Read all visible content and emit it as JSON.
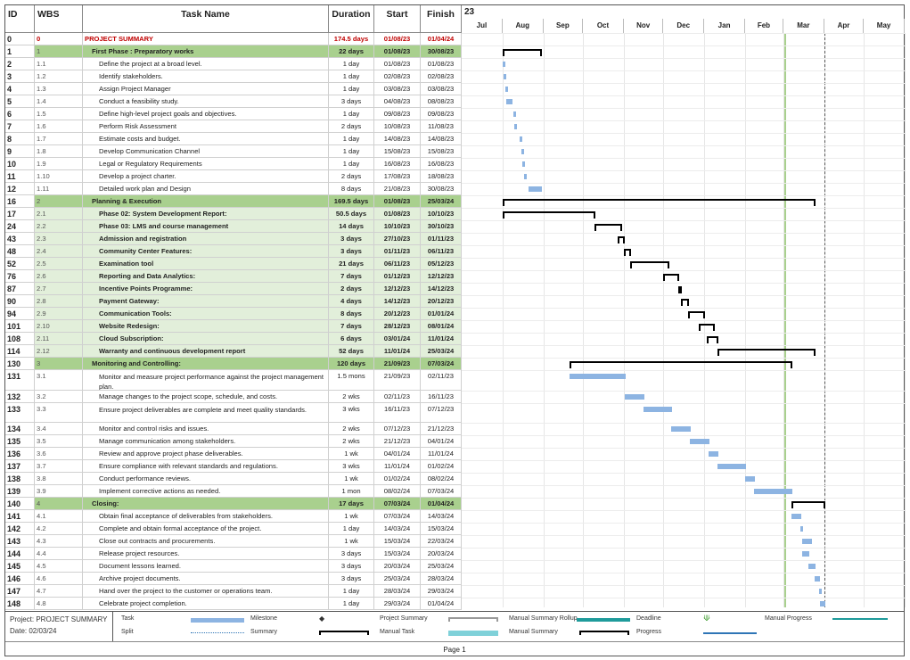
{
  "headers": {
    "id": "ID",
    "wbs": "WBS",
    "name": "Task Name",
    "duration": "Duration",
    "start": "Start",
    "finish": "Finish"
  },
  "timescale": {
    "year": "23",
    "months": [
      "Jul",
      "Aug",
      "Sep",
      "Oct",
      "Nov",
      "Dec",
      "Jan",
      "Feb",
      "Mar",
      "Apr",
      "May"
    ]
  },
  "rows": [
    {
      "id": "0",
      "wbs": "0",
      "name": "PROJECT SUMMARY",
      "dur": "174.5 days",
      "start": "01/08/23",
      "fin": "01/04/24"
    },
    {
      "id": "1",
      "wbs": "1",
      "name": "First Phase : Preparatory works",
      "dur": "22 days",
      "start": "01/08/23",
      "fin": "30/08/23"
    },
    {
      "id": "2",
      "wbs": "1.1",
      "name": "Define the project at a broad level.",
      "dur": "1 day",
      "start": "01/08/23",
      "fin": "01/08/23"
    },
    {
      "id": "3",
      "wbs": "1.2",
      "name": "Identify stakeholders.",
      "dur": "1 day",
      "start": "02/08/23",
      "fin": "02/08/23"
    },
    {
      "id": "4",
      "wbs": "1.3",
      "name": "Assign Project Manager",
      "dur": "1 day",
      "start": "03/08/23",
      "fin": "03/08/23"
    },
    {
      "id": "5",
      "wbs": "1.4",
      "name": "Conduct a feasibility study.",
      "dur": "3 days",
      "start": "04/08/23",
      "fin": "08/08/23"
    },
    {
      "id": "6",
      "wbs": "1.5",
      "name": "Define high-level project goals and objectives.",
      "dur": "1 day",
      "start": "09/08/23",
      "fin": "09/08/23"
    },
    {
      "id": "7",
      "wbs": "1.6",
      "name": "Perform Risk Assessment",
      "dur": "2 days",
      "start": "10/08/23",
      "fin": "11/08/23"
    },
    {
      "id": "8",
      "wbs": "1.7",
      "name": "Estimate costs and budget.",
      "dur": "1 day",
      "start": "14/08/23",
      "fin": "14/08/23"
    },
    {
      "id": "9",
      "wbs": "1.8",
      "name": "Develop Communication Channel",
      "dur": "1 day",
      "start": "15/08/23",
      "fin": "15/08/23"
    },
    {
      "id": "10",
      "wbs": "1.9",
      "name": "Legal or Regulatory Requirements",
      "dur": "1 day",
      "start": "16/08/23",
      "fin": "16/08/23"
    },
    {
      "id": "11",
      "wbs": "1.10",
      "name": "Develop a project charter.",
      "dur": "2 days",
      "start": "17/08/23",
      "fin": "18/08/23"
    },
    {
      "id": "12",
      "wbs": "1.11",
      "name": "Detailed work plan and Design",
      "dur": "8 days",
      "start": "21/08/23",
      "fin": "30/08/23"
    },
    {
      "id": "16",
      "wbs": "2",
      "name": "Planning & Execution",
      "dur": "169.5 days",
      "start": "01/08/23",
      "fin": "25/03/24"
    },
    {
      "id": "17",
      "wbs": "2.1",
      "name": "Phase 02: System Development Report:",
      "dur": "50.5 days",
      "start": "01/08/23",
      "fin": "10/10/23"
    },
    {
      "id": "24",
      "wbs": "2.2",
      "name": "Phase 03: LMS and course management",
      "dur": "14 days",
      "start": "10/10/23",
      "fin": "30/10/23"
    },
    {
      "id": "43",
      "wbs": "2.3",
      "name": "Admission and registration",
      "dur": "3 days",
      "start": "27/10/23",
      "fin": "01/11/23"
    },
    {
      "id": "48",
      "wbs": "2.4",
      "name": "Community Center Features:",
      "dur": "3 days",
      "start": "01/11/23",
      "fin": "06/11/23"
    },
    {
      "id": "52",
      "wbs": "2.5",
      "name": "Examination tool",
      "dur": "21 days",
      "start": "06/11/23",
      "fin": "05/12/23"
    },
    {
      "id": "76",
      "wbs": "2.6",
      "name": "Reporting and Data Analytics:",
      "dur": "7 days",
      "start": "01/12/23",
      "fin": "12/12/23"
    },
    {
      "id": "87",
      "wbs": "2.7",
      "name": "Incentive Points Programme:",
      "dur": "2 days",
      "start": "12/12/23",
      "fin": "14/12/23"
    },
    {
      "id": "90",
      "wbs": "2.8",
      "name": "Payment Gateway:",
      "dur": "4 days",
      "start": "14/12/23",
      "fin": "20/12/23"
    },
    {
      "id": "94",
      "wbs": "2.9",
      "name": "Communication Tools:",
      "dur": "8 days",
      "start": "20/12/23",
      "fin": "01/01/24"
    },
    {
      "id": "101",
      "wbs": "2.10",
      "name": "Website Redesign:",
      "dur": "7 days",
      "start": "28/12/23",
      "fin": "08/01/24"
    },
    {
      "id": "108",
      "wbs": "2.11",
      "name": "Cloud Subscription:",
      "dur": "6 days",
      "start": "03/01/24",
      "fin": "11/01/24"
    },
    {
      "id": "114",
      "wbs": "2.12",
      "name": "Warranty and continuous development report",
      "dur": "52 days",
      "start": "11/01/24",
      "fin": "25/03/24"
    },
    {
      "id": "130",
      "wbs": "3",
      "name": "Monitoring and Controlling:",
      "dur": "120 days",
      "start": "21/09/23",
      "fin": "07/03/24"
    },
    {
      "id": "131",
      "wbs": "3.1",
      "name": "Monitor and measure project performance against the project management plan.",
      "dur": "1.5 mons",
      "start": "21/09/23",
      "fin": "02/11/23"
    },
    {
      "id": "132",
      "wbs": "3.2",
      "name": "Manage changes to the project scope, schedule, and costs.",
      "dur": "2 wks",
      "start": "02/11/23",
      "fin": "16/11/23"
    },
    {
      "id": "133",
      "wbs": "3.3",
      "name": "Ensure project deliverables are complete and meet quality standards.",
      "dur": "3 wks",
      "start": "16/11/23",
      "fin": "07/12/23"
    },
    {
      "id": "134",
      "wbs": "3.4",
      "name": "Monitor and control risks and issues.",
      "dur": "2 wks",
      "start": "07/12/23",
      "fin": "21/12/23"
    },
    {
      "id": "135",
      "wbs": "3.5",
      "name": "Manage communication among stakeholders.",
      "dur": "2 wks",
      "start": "21/12/23",
      "fin": "04/01/24"
    },
    {
      "id": "136",
      "wbs": "3.6",
      "name": "Review and approve project phase deliverables.",
      "dur": "1 wk",
      "start": "04/01/24",
      "fin": "11/01/24"
    },
    {
      "id": "137",
      "wbs": "3.7",
      "name": "Ensure compliance with relevant standards and regulations.",
      "dur": "3 wks",
      "start": "11/01/24",
      "fin": "01/02/24"
    },
    {
      "id": "138",
      "wbs": "3.8",
      "name": "Conduct performance reviews.",
      "dur": "1 wk",
      "start": "01/02/24",
      "fin": "08/02/24"
    },
    {
      "id": "139",
      "wbs": "3.9",
      "name": "Implement corrective actions as needed.",
      "dur": "1 mon",
      "start": "08/02/24",
      "fin": "07/03/24"
    },
    {
      "id": "140",
      "wbs": "4",
      "name": "Closing:",
      "dur": "17 days",
      "start": "07/03/24",
      "fin": "01/04/24"
    },
    {
      "id": "141",
      "wbs": "4.1",
      "name": "Obtain final acceptance of deliverables from stakeholders.",
      "dur": "1 wk",
      "start": "07/03/24",
      "fin": "14/03/24"
    },
    {
      "id": "142",
      "wbs": "4.2",
      "name": "Complete and obtain formal acceptance of the project.",
      "dur": "1 day",
      "start": "14/03/24",
      "fin": "15/03/24"
    },
    {
      "id": "143",
      "wbs": "4.3",
      "name": "Close out contracts and procurements.",
      "dur": "1 wk",
      "start": "15/03/24",
      "fin": "22/03/24"
    },
    {
      "id": "144",
      "wbs": "4.4",
      "name": "Release project resources.",
      "dur": "3 days",
      "start": "15/03/24",
      "fin": "20/03/24"
    },
    {
      "id": "145",
      "wbs": "4.5",
      "name": "Document lessons learned.",
      "dur": "3 days",
      "start": "20/03/24",
      "fin": "25/03/24"
    },
    {
      "id": "146",
      "wbs": "4.6",
      "name": "Archive project documents.",
      "dur": "3 days",
      "start": "25/03/24",
      "fin": "28/03/24"
    },
    {
      "id": "147",
      "wbs": "4.7",
      "name": "Hand over the project to the customer or operations team.",
      "dur": "1 day",
      "start": "28/03/24",
      "fin": "29/03/24"
    },
    {
      "id": "148",
      "wbs": "4.8",
      "name": "Celebrate project completion.",
      "dur": "1 day",
      "start": "29/03/24",
      "fin": "01/04/24"
    }
  ],
  "legend": {
    "project": "Project: PROJECT SUMMARY",
    "date": "Date: 02/03/24",
    "task": "Task",
    "split": "Split",
    "milestone": "Milestone",
    "summary": "Summary",
    "project_summary": "Project Summary",
    "manual_task": "Manual Task",
    "manual_summary_rollup": "Manual Summary Rollup",
    "manual_summary": "Manual Summary",
    "deadline": "Deadline",
    "progress": "Progress",
    "manual_progress": "Manual Progress"
  },
  "footer": {
    "page": "Page 1"
  },
  "colors": {
    "summary_row": "#a9d08e",
    "sub_row": "#e2efda",
    "task_bar": "#8db4e2",
    "project_text": "#c00000"
  }
}
